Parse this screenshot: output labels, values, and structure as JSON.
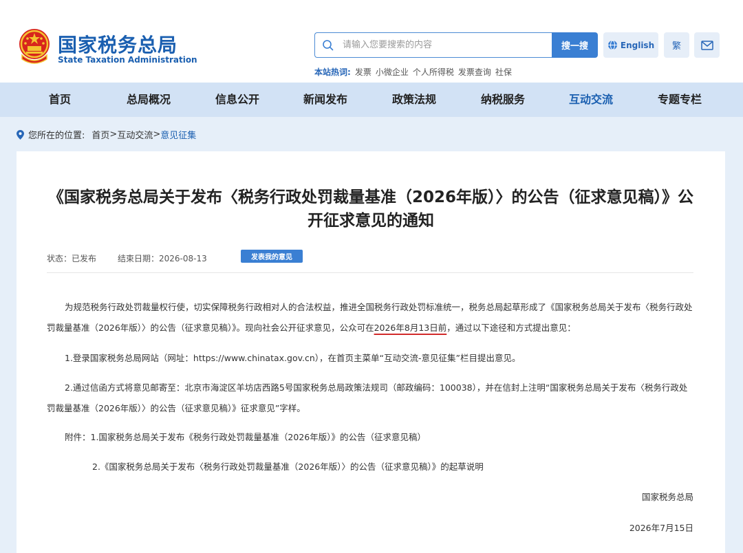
{
  "header": {
    "site_name": "国家税务总局",
    "site_name_en": "State Taxation Administration",
    "search_placeholder": "请输入您要搜索的内容",
    "search_button": "搜一搜",
    "english_label": "English",
    "traditional_label": "繁",
    "hot_label": "本站热词:",
    "hot_words": [
      "发票",
      "小微企业",
      "个人所得税",
      "发票查询",
      "社保"
    ]
  },
  "nav": {
    "items": [
      "首页",
      "总局概况",
      "信息公开",
      "新闻发布",
      "政策法规",
      "纳税服务",
      "互动交流",
      "专题专栏"
    ],
    "active_index": 6
  },
  "breadcrumb": {
    "label": "您所在的位置:",
    "home": "首页",
    "sep1": ">",
    "section": "互动交流",
    "sep2": ">",
    "current": "意见征集"
  },
  "article": {
    "title": "《国家税务总局关于发布〈税务行政处罚裁量基准（2026年版）〉的公告（征求意见稿）》公开征求意见的通知",
    "status": "状态：已发布",
    "end_date": "结束日期：2026-08-13",
    "opinion_button": "发表我的意见",
    "para1_a": "为规范税务行政处罚裁量权行使，切实保障税务行政相对人的合法权益，推进全国税务行政处罚标准统一，税务总局起草形成了《国家税务总局关于发布〈税务行政处罚裁量基准（2026年版）〉的公告（征求意见稿）》。现向社会公开征求意见，公众可在",
    "para1_deadline": "2026年8月13日前",
    "para1_b": "，通过以下途径和方式提出意见：",
    "para2": "1.登录国家税务总局网站（网址：https://www.chinatax.gov.cn），在首页主菜单“互动交流-意见征集”栏目提出意见。",
    "para3": "2.通过信函方式将意见邮寄至：北京市海淀区羊坊店西路5号国家税务总局政策法规司（邮政编码：100038），并在信封上注明“国家税务总局关于发布〈税务行政处罚裁量基准（2026年版）〉的公告（征求意见稿）》征求意见”字样。",
    "attach1": "附件：1.国家税务总局关于发布《税务行政处罚裁量基准（2026年版）》的公告（征求意见稿）",
    "attach2": "2.《国家税务总局关于发布〈税务行政处罚裁量基准（2026年版）〉的公告（征求意见稿）》的起草说明",
    "signature": "国家税务总局",
    "date": "2026年7月15日"
  },
  "colors": {
    "brand": "#1a5fb0",
    "button": "#3a7fd3",
    "nav_bg": "#d2e2f5",
    "page_bg": "#e6eff9",
    "underline": "#d12a2a"
  },
  "icons": [
    "national-emblem-icon",
    "search-icon",
    "globe-icon",
    "mail-icon",
    "location-pin-icon"
  ]
}
